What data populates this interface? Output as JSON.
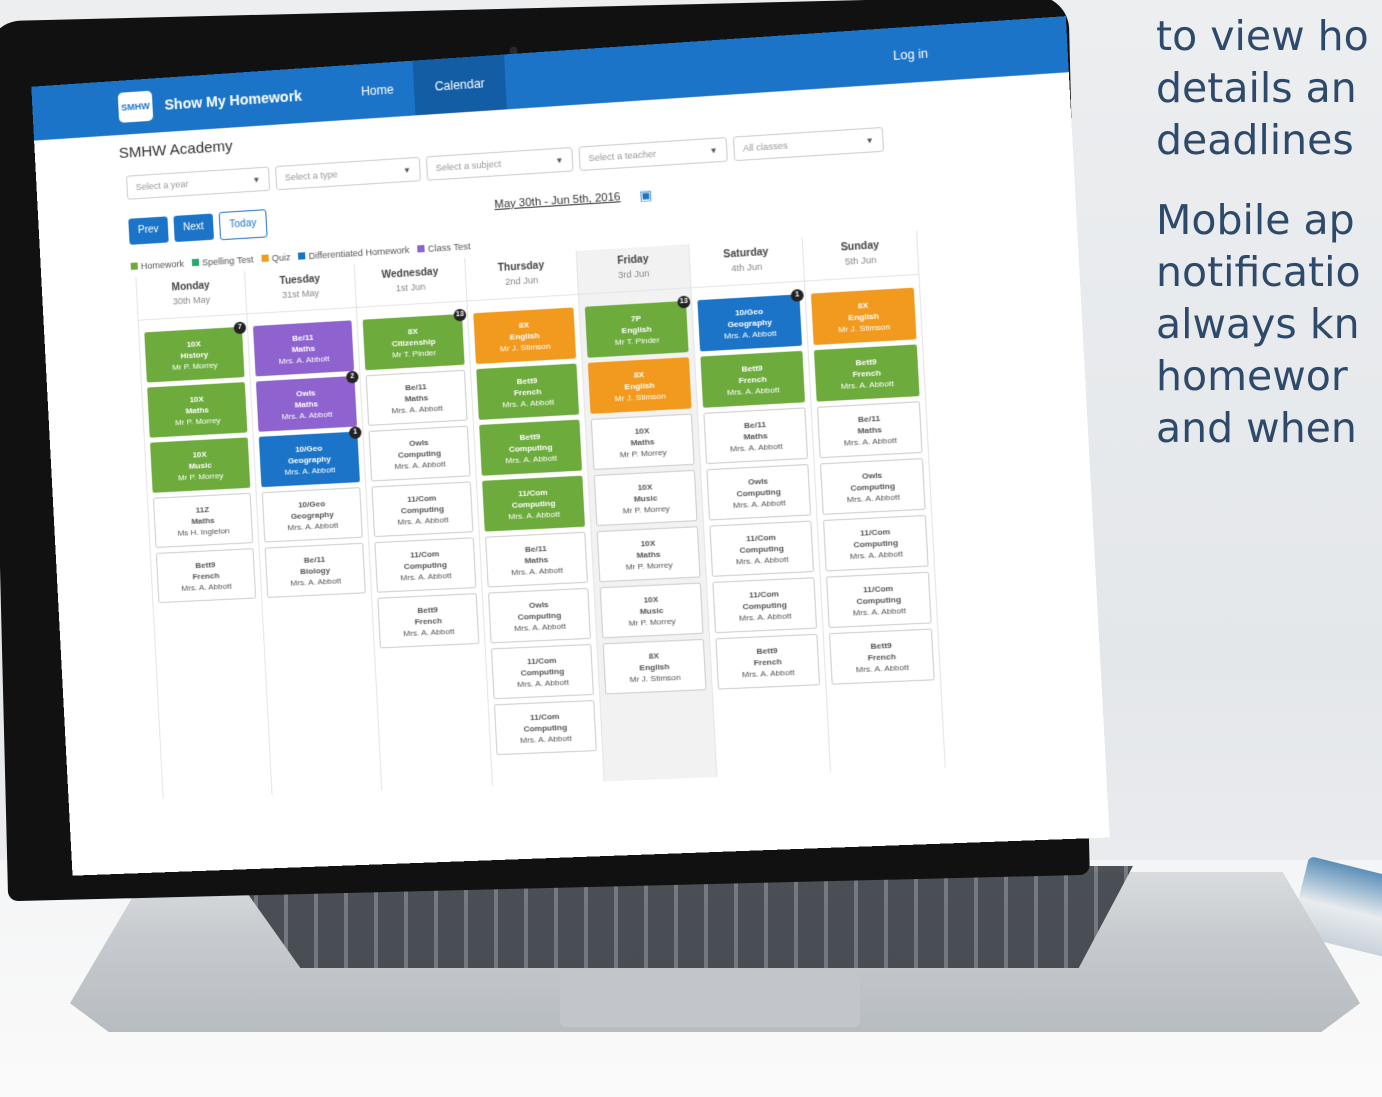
{
  "side_text": {
    "para1": [
      "to view ho",
      "details an",
      "deadlines"
    ],
    "para2": [
      "Mobile ap",
      "notificatio",
      "always kn",
      "homewor",
      "and when"
    ]
  },
  "navbar": {
    "brand": "Show My Homework",
    "logo_text": "SMHW",
    "links": [
      "Home",
      "Calendar"
    ],
    "login": "Log in"
  },
  "school": "SMHW Academy",
  "filters": [
    "Select a year",
    "Select a type",
    "Select a subject",
    "Select a teacher",
    "All classes"
  ],
  "controls": {
    "prev": "Prev",
    "next": "Next",
    "today": "Today",
    "date_range": "May 30th - Jun 5th, 2016"
  },
  "legend": [
    {
      "label": "Homework",
      "color": "#6cab3c"
    },
    {
      "label": "Spelling Test",
      "color": "#2aa673"
    },
    {
      "label": "Quiz",
      "color": "#f19a1e"
    },
    {
      "label": "Differentiated Homework",
      "color": "#1b74c8"
    },
    {
      "label": "Class Test",
      "color": "#8e63cf"
    }
  ],
  "colors": {
    "homework": "#6cab3c",
    "quiz": "#f19a1e",
    "differentiated": "#1b74c8",
    "class_test": "#8e63cf",
    "outline": "#cccccc"
  },
  "days": [
    {
      "name": "Monday",
      "date": "30th May",
      "items": [
        {
          "cls": "10X",
          "subject": "History",
          "teacher": "Mr P. Morrey",
          "type": "homework",
          "badge": "7"
        },
        {
          "cls": "10X",
          "subject": "Maths",
          "teacher": "Mr P. Morrey",
          "type": "homework"
        },
        {
          "cls": "10X",
          "subject": "Music",
          "teacher": "Mr P. Morrey",
          "type": "homework"
        },
        {
          "cls": "11Z",
          "subject": "Maths",
          "teacher": "Ms H. Ingleton",
          "type": "outline"
        },
        {
          "cls": "Bett9",
          "subject": "French",
          "teacher": "Mrs. A. Abbott",
          "type": "outline"
        }
      ]
    },
    {
      "name": "Tuesday",
      "date": "31st May",
      "items": [
        {
          "cls": "Be/11",
          "subject": "Maths",
          "teacher": "Mrs. A. Abbott",
          "type": "class_test"
        },
        {
          "cls": "Owls",
          "subject": "Maths",
          "teacher": "Mrs. A. Abbott",
          "type": "class_test",
          "badge": "2"
        },
        {
          "cls": "10/Geo",
          "subject": "Geography",
          "teacher": "Mrs. A. Abbott",
          "type": "differentiated",
          "badge": "1"
        },
        {
          "cls": "10/Geo",
          "subject": "Geography",
          "teacher": "Mrs. A. Abbott",
          "type": "outline"
        },
        {
          "cls": "Be/11",
          "subject": "Biology",
          "teacher": "Mrs. A. Abbott",
          "type": "outline"
        }
      ]
    },
    {
      "name": "Wednesday",
      "date": "1st Jun",
      "items": [
        {
          "cls": "8X",
          "subject": "Citizenship",
          "teacher": "Mr T. Pinder",
          "type": "homework",
          "badge": "13"
        },
        {
          "cls": "Be/11",
          "subject": "Maths",
          "teacher": "Mrs. A. Abbott",
          "type": "outline"
        },
        {
          "cls": "Owls",
          "subject": "Computing",
          "teacher": "Mrs. A. Abbott",
          "type": "outline"
        },
        {
          "cls": "11/Com",
          "subject": "Computing",
          "teacher": "Mrs. A. Abbott",
          "type": "outline"
        },
        {
          "cls": "11/Com",
          "subject": "Computing",
          "teacher": "Mrs. A. Abbott",
          "type": "outline"
        },
        {
          "cls": "Bett9",
          "subject": "French",
          "teacher": "Mrs. A. Abbott",
          "type": "outline"
        }
      ]
    },
    {
      "name": "Thursday",
      "date": "2nd Jun",
      "items": [
        {
          "cls": "8X",
          "subject": "English",
          "teacher": "Mr J. Stimson",
          "type": "quiz"
        },
        {
          "cls": "Bett9",
          "subject": "French",
          "teacher": "Mrs. A. Abbott",
          "type": "homework"
        },
        {
          "cls": "Bett9",
          "subject": "Computing",
          "teacher": "Mrs. A. Abbott",
          "type": "homework"
        },
        {
          "cls": "11/Com",
          "subject": "Computing",
          "teacher": "Mrs. A. Abbott",
          "type": "homework"
        },
        {
          "cls": "Be/11",
          "subject": "Maths",
          "teacher": "Mrs. A. Abbott",
          "type": "outline"
        },
        {
          "cls": "Owls",
          "subject": "Computing",
          "teacher": "Mrs. A. Abbott",
          "type": "outline"
        },
        {
          "cls": "11/Com",
          "subject": "Computing",
          "teacher": "Mrs. A. Abbott",
          "type": "outline"
        },
        {
          "cls": "11/Com",
          "subject": "Computing",
          "teacher": "Mrs. A. Abbott",
          "type": "outline"
        }
      ]
    },
    {
      "name": "Friday",
      "date": "3rd Jun",
      "items": [
        {
          "cls": "7P",
          "subject": "English",
          "teacher": "Mr T. Pinder",
          "type": "homework",
          "badge": "13"
        },
        {
          "cls": "8X",
          "subject": "English",
          "teacher": "Mr J. Stimson",
          "type": "quiz"
        },
        {
          "cls": "10X",
          "subject": "Maths",
          "teacher": "Mr P. Morrey",
          "type": "outline"
        },
        {
          "cls": "10X",
          "subject": "Music",
          "teacher": "Mr P. Morrey",
          "type": "outline"
        },
        {
          "cls": "10X",
          "subject": "Maths",
          "teacher": "Mr P. Morrey",
          "type": "outline"
        },
        {
          "cls": "10X",
          "subject": "Music",
          "teacher": "Mr P. Morrey",
          "type": "outline"
        },
        {
          "cls": "8X",
          "subject": "English",
          "teacher": "Mr J. Stimson",
          "type": "outline"
        }
      ]
    },
    {
      "name": "Saturday",
      "date": "4th Jun",
      "items": [
        {
          "cls": "10/Geo",
          "subject": "Geography",
          "teacher": "Mrs. A. Abbott",
          "type": "differentiated",
          "badge": "1"
        },
        {
          "cls": "Bett9",
          "subject": "French",
          "teacher": "Mrs. A. Abbott",
          "type": "homework"
        },
        {
          "cls": "Be/11",
          "subject": "Maths",
          "teacher": "Mrs. A. Abbott",
          "type": "outline"
        },
        {
          "cls": "Owls",
          "subject": "Computing",
          "teacher": "Mrs. A. Abbott",
          "type": "outline"
        },
        {
          "cls": "11/Com",
          "subject": "Computing",
          "teacher": "Mrs. A. Abbott",
          "type": "outline"
        },
        {
          "cls": "11/Com",
          "subject": "Computing",
          "teacher": "Mrs. A. Abbott",
          "type": "outline"
        },
        {
          "cls": "Bett9",
          "subject": "French",
          "teacher": "Mrs. A. Abbott",
          "type": "outline"
        }
      ]
    },
    {
      "name": "Sunday",
      "date": "5th Jun",
      "items": [
        {
          "cls": "8X",
          "subject": "English",
          "teacher": "Mr J. Stimson",
          "type": "quiz"
        },
        {
          "cls": "Bett9",
          "subject": "French",
          "teacher": "Mrs. A. Abbott",
          "type": "homework"
        },
        {
          "cls": "Be/11",
          "subject": "Maths",
          "teacher": "Mrs. A. Abbott",
          "type": "outline"
        },
        {
          "cls": "Owls",
          "subject": "Computing",
          "teacher": "Mrs. A. Abbott",
          "type": "outline"
        },
        {
          "cls": "11/Com",
          "subject": "Computing",
          "teacher": "Mrs. A. Abbott",
          "type": "outline"
        },
        {
          "cls": "11/Com",
          "subject": "Computing",
          "teacher": "Mrs. A. Abbott",
          "type": "outline"
        },
        {
          "cls": "Bett9",
          "subject": "French",
          "teacher": "Mrs. A. Abbott",
          "type": "outline"
        }
      ]
    }
  ]
}
